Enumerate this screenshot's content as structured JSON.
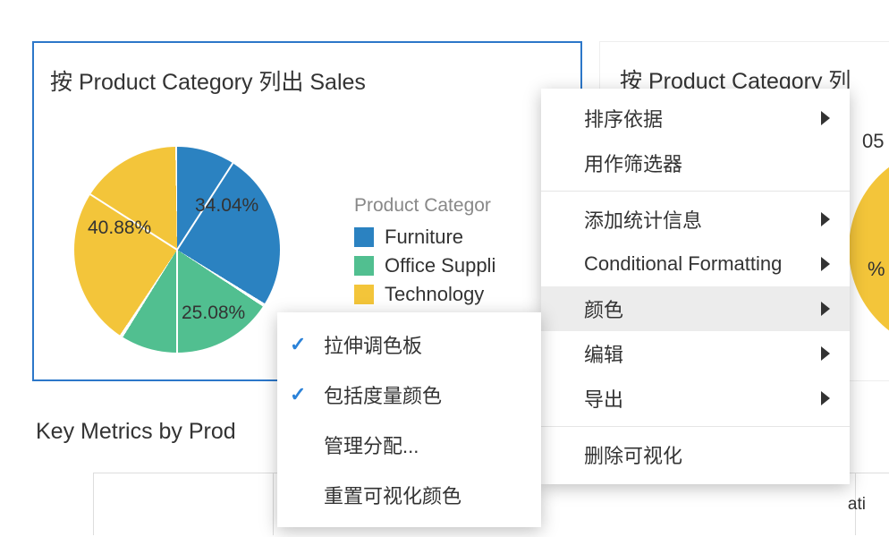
{
  "panels": {
    "left": {
      "title": "按 Product Category 列出 Sales"
    },
    "right": {
      "title": "按 Product Category 列",
      "fragment05": "05",
      "fragmentPct": "%"
    }
  },
  "legend": {
    "title": "Product Categor",
    "items": [
      "Furniture",
      "Office Suppli",
      "Technology"
    ]
  },
  "slice_labels": [
    "34.04%",
    "25.08%",
    "40.88%"
  ],
  "section_title": "Key Metrics by Prod",
  "table_cell_fragment": "ati",
  "context_menu": {
    "items": [
      {
        "label": "排序依据",
        "submenu": true
      },
      {
        "label": "用作筛选器",
        "submenu": false
      },
      {
        "label": "添加统计信息",
        "submenu": true
      },
      {
        "label": "Conditional Formatting",
        "submenu": true
      },
      {
        "label": "颜色",
        "submenu": true,
        "hover": true
      },
      {
        "label": "编辑",
        "submenu": true
      },
      {
        "label": "导出",
        "submenu": true
      },
      {
        "label": "删除可视化",
        "submenu": false
      }
    ],
    "submenu_items": [
      {
        "label": "拉伸调色板",
        "checked": true
      },
      {
        "label": "包括度量颜色",
        "checked": true
      },
      {
        "label": "管理分配...",
        "checked": false
      },
      {
        "label": "重置可视化颜色",
        "checked": false
      }
    ]
  },
  "colors": {
    "furniture": "#2b82c1",
    "office_supplies": "#51bf90",
    "technology": "#f3c53a",
    "selection_border": "#2c77c9"
  },
  "chart_data": {
    "type": "pie",
    "title": "按 Product Category 列出 Sales",
    "legend_title": "Product Category",
    "series": [
      {
        "name": "Furniture",
        "value": 34.04,
        "color": "#2b82c1"
      },
      {
        "name": "Office Supplies",
        "value": 25.08,
        "color": "#51bf90"
      },
      {
        "name": "Technology",
        "value": 40.88,
        "color": "#f3c53a"
      }
    ],
    "unit": "percent"
  }
}
